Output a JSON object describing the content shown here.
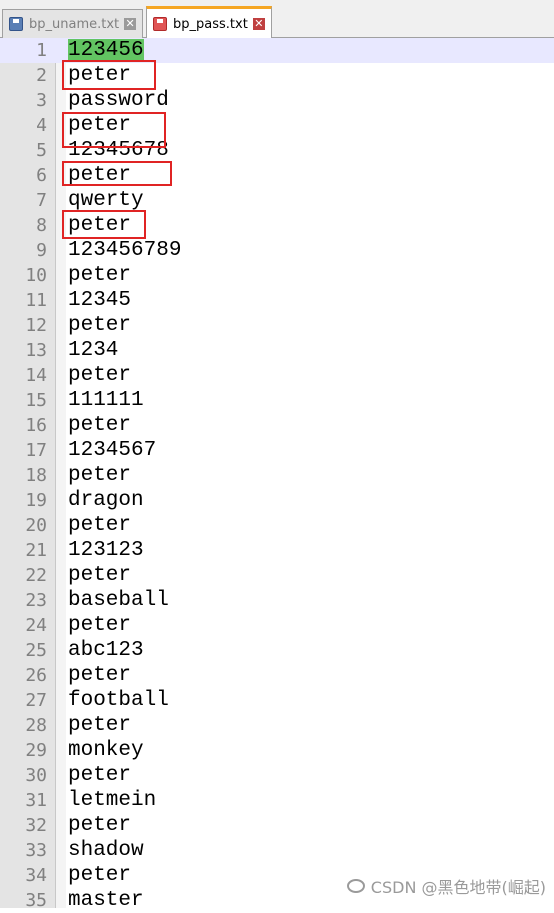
{
  "tabs": [
    {
      "label": "bp_uname.txt",
      "active": false,
      "icon": "saved-file-icon"
    },
    {
      "label": "bp_pass.txt",
      "active": true,
      "icon": "unsaved-file-icon"
    }
  ],
  "close_glyph": "✕",
  "lines": [
    {
      "n": "1",
      "text": "123456"
    },
    {
      "n": "2",
      "text": "peter"
    },
    {
      "n": "3",
      "text": "password"
    },
    {
      "n": "4",
      "text": "peter"
    },
    {
      "n": "5",
      "text": "12345678"
    },
    {
      "n": "6",
      "text": "peter"
    },
    {
      "n": "7",
      "text": "qwerty"
    },
    {
      "n": "8",
      "text": "peter"
    },
    {
      "n": "9",
      "text": "123456789"
    },
    {
      "n": "10",
      "text": "peter"
    },
    {
      "n": "11",
      "text": "12345"
    },
    {
      "n": "12",
      "text": "peter"
    },
    {
      "n": "13",
      "text": "1234"
    },
    {
      "n": "14",
      "text": "peter"
    },
    {
      "n": "15",
      "text": "111111"
    },
    {
      "n": "16",
      "text": "peter"
    },
    {
      "n": "17",
      "text": "1234567"
    },
    {
      "n": "18",
      "text": "peter"
    },
    {
      "n": "19",
      "text": "dragon"
    },
    {
      "n": "20",
      "text": "peter"
    },
    {
      "n": "21",
      "text": "123123"
    },
    {
      "n": "22",
      "text": "peter"
    },
    {
      "n": "23",
      "text": "baseball"
    },
    {
      "n": "24",
      "text": "peter"
    },
    {
      "n": "25",
      "text": "abc123"
    },
    {
      "n": "26",
      "text": "peter"
    },
    {
      "n": "27",
      "text": "football"
    },
    {
      "n": "28",
      "text": "peter"
    },
    {
      "n": "29",
      "text": "monkey"
    },
    {
      "n": "30",
      "text": "peter"
    },
    {
      "n": "31",
      "text": "letmein"
    },
    {
      "n": "32",
      "text": "peter"
    },
    {
      "n": "33",
      "text": "shadow"
    },
    {
      "n": "34",
      "text": "peter"
    },
    {
      "n": "35",
      "text": "master"
    }
  ],
  "current_line": 1,
  "highlighted_lines": [
    2,
    4,
    6,
    8
  ],
  "colors": {
    "highlight_box": "#e02424",
    "selection": "#62c462",
    "active_tab_accent": "#f5a623"
  },
  "watermark": "CSDN @黑色地带(崛起)"
}
